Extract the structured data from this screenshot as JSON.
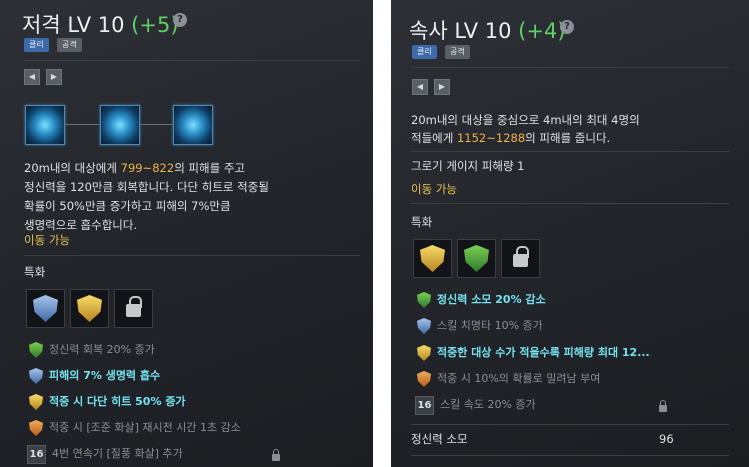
{
  "left": {
    "title": {
      "name": "저격 LV 10",
      "bonus": "(+5)"
    },
    "help_icon": "?",
    "tags": [
      "클리",
      "공격"
    ],
    "nav": {
      "prev": "◀",
      "next": "▶"
    },
    "skill_icons": [
      "sniping-stage-1-icon",
      "sniping-stage-2-icon",
      "sniping-stage-3-icon"
    ],
    "description": {
      "l1_pre": "20m내의 대상에게 ",
      "l1_val": "799~822",
      "l1_post": "의 피해를 주고",
      "l2": "정신력을 120만큼 회복합니다. 다단 히트로 적중될",
      "l3": "확률이 50%만큼 증가하고 피해의 7%만큼",
      "l4": "생명력으로 흡수합니다."
    },
    "movable": "이동 가능",
    "spec_label": "특화",
    "spec_icons": [
      "blue-shield-icon",
      "gold-shield-icon",
      "locked-chain-icon"
    ],
    "spec_rows": [
      {
        "icon": "green-shield-icon",
        "text": "정신력 회복 20% 증가",
        "style": "dim"
      },
      {
        "icon": "blue-shield-icon",
        "text": "피해의 7% 생명력 흡수",
        "style": "bright"
      },
      {
        "icon": "gold-shield-icon",
        "text": "적중 시 다단 히트 50% 증가",
        "style": "bright"
      },
      {
        "icon": "orange-shield-icon",
        "text": "적중 시 [조준 화살] 재시전 시간 1초 감소",
        "style": "dim"
      },
      {
        "number": "16",
        "text": "4번 연속기 [질풍 화살] 추가",
        "style": "dim",
        "locked": true
      }
    ]
  },
  "right": {
    "title": {
      "name": "속사 LV 10",
      "bonus": "(+4)"
    },
    "help_icon": "?",
    "tags": [
      "클리",
      "공격"
    ],
    "nav": {
      "prev": "◀",
      "next": "▶"
    },
    "description": {
      "l1": "20m내의 대상을 중심으로 4m내의 최대 4명의",
      "l2_pre": "적들에게 ",
      "l2_val": "1152~1288",
      "l2_post": "의 피해를 줍니다."
    },
    "gauge_line": "그로기 게이지 피해량 1",
    "movable": "이동 가능",
    "spec_label": "특화",
    "spec_icons": [
      "gold-shield-icon",
      "green-shield-icon",
      "locked-chain-icon"
    ],
    "spec_rows": [
      {
        "icon": "green-shield-icon",
        "text": "정신력 소모 20% 감소",
        "style": "bright"
      },
      {
        "icon": "blue-shield-icon",
        "text": "스킬 치명타 10% 증가",
        "style": "dim"
      },
      {
        "icon": "gold-shield-icon",
        "text": "적중한 대상 수가 적을수록 피해량 최대 12...",
        "style": "bright"
      },
      {
        "icon": "orange-shield-icon",
        "text": "적중 시 10%의 확률로 밀려남 부여",
        "style": "dim"
      },
      {
        "number": "16",
        "text": "스킬 속도 20% 증가",
        "style": "dim",
        "locked": true
      }
    ],
    "stat": {
      "label": "정신력 소모",
      "value": "96"
    }
  },
  "colors": {
    "panel_bg": "#23262b",
    "bonus_green": "#5fd064",
    "damage_orange": "#f2b24a",
    "movable_yellow": "#e9c24f",
    "spec_highlight": "#76e3f0"
  }
}
